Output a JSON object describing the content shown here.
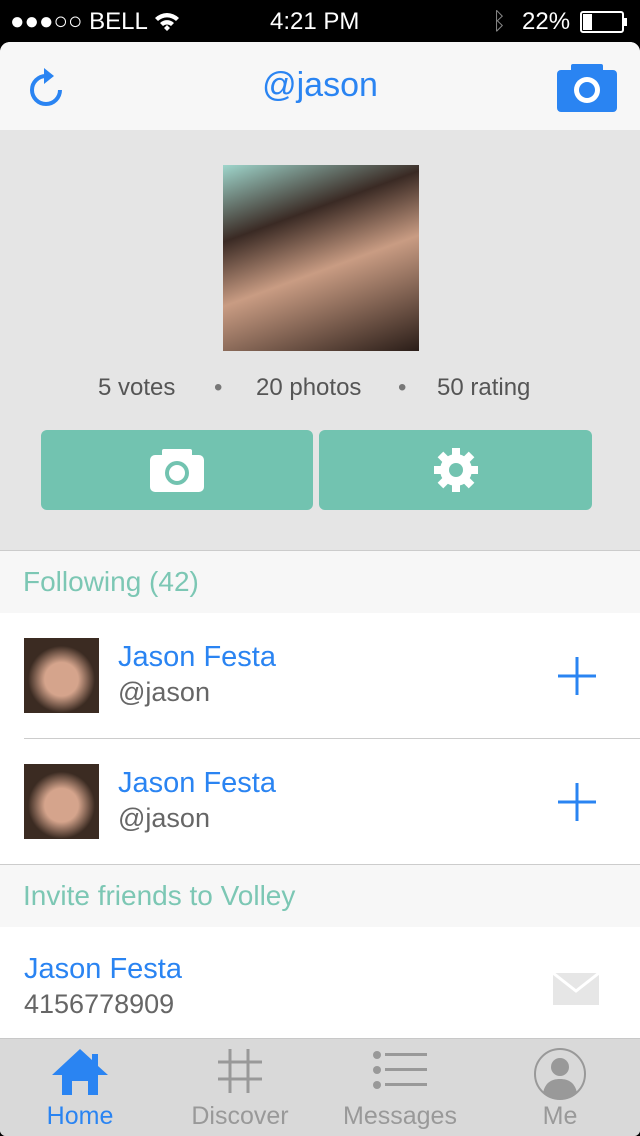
{
  "status": {
    "carrier": "●●●○○ BELL",
    "time": "4:21 PM",
    "battery": "22%"
  },
  "nav": {
    "title": "@jason"
  },
  "profile": {
    "votes": "5 votes",
    "photos": "20 photos",
    "rating": "50 rating",
    "sep": "•"
  },
  "following": {
    "header": "Following (42)",
    "items": [
      {
        "name": "Jason Festa",
        "handle": "@jason"
      },
      {
        "name": "Jason Festa",
        "handle": "@jason"
      }
    ]
  },
  "invite": {
    "header": "Invite friends to Volley",
    "items": [
      {
        "name": "Jason Festa",
        "phone": "4156778909"
      }
    ]
  },
  "tabs": [
    {
      "label": "Home"
    },
    {
      "label": "Discover"
    },
    {
      "label": "Messages"
    },
    {
      "label": "Me"
    }
  ],
  "colors": {
    "accent": "#2a84f2",
    "teal": "#72c3b0"
  }
}
